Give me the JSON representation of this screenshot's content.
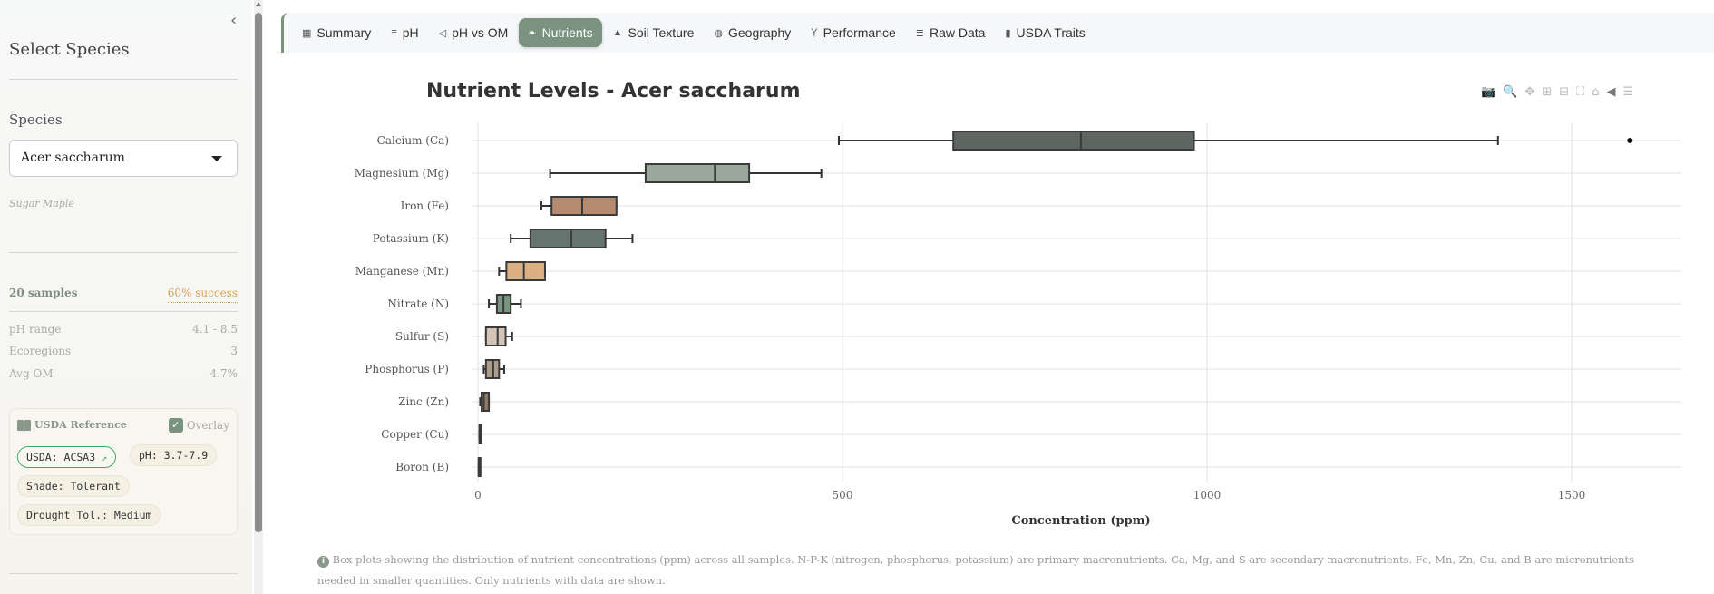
{
  "sidebar": {
    "title": "Select Species",
    "species_label": "Species",
    "species_value": "Acer saccharum",
    "common_name": "Sugar Maple",
    "samples": "20 samples",
    "success": "60% success",
    "stats": [
      {
        "label": "pH range",
        "value": "4.1 - 8.5"
      },
      {
        "label": "Ecoregions",
        "value": "3"
      },
      {
        "label": "Avg OM",
        "value": "4.7%"
      }
    ],
    "usda": {
      "title": "USDA Reference",
      "overlay": "Overlay",
      "overlay_checked": true,
      "pills": [
        "USDA: ACSA3",
        "pH: 3.7-7.9",
        "Shade: Tolerant",
        "Drought Tol.: Medium"
      ]
    }
  },
  "tabs": [
    {
      "label": "Summary",
      "icon": "▦"
    },
    {
      "label": "pH",
      "icon": "≡"
    },
    {
      "label": "pH vs OM",
      "icon": "◁"
    },
    {
      "label": "Nutrients",
      "icon": "❧"
    },
    {
      "label": "Soil Texture",
      "icon": "▲"
    },
    {
      "label": "Geography",
      "icon": "◍"
    },
    {
      "label": "Performance",
      "icon": "Ỵ"
    },
    {
      "label": "Raw Data",
      "icon": "≣"
    },
    {
      "label": "USDA Traits",
      "icon": "▮"
    }
  ],
  "active_tab": "Nutrients",
  "note": "Box plots showing the distribution of nutrient concentrations (ppm) across all samples. N-P-K (nitrogen, phosphorus, potassium) are primary macronutrients. Ca, Mg, and S are secondary macronutrients. Fe, Mn, Zn, Cu, and B are micronutrients needed in smaller quantities. Only nutrients with data are shown.",
  "chart_data": {
    "type": "box",
    "title": "Nutrient Levels - Acer saccharum",
    "xlabel": "Concentration (ppm)",
    "xlim": [
      -60,
      1660
    ],
    "xticks": [
      0,
      500,
      1000,
      1500
    ],
    "grid": true,
    "series": [
      {
        "name": "Calcium (Ca)",
        "min": 495,
        "q1": 652,
        "median": 827,
        "q3": 982,
        "max": 1399,
        "outliers": [
          1580
        ],
        "color": "#5f6661"
      },
      {
        "name": "Magnesium (Mg)",
        "min": 99,
        "q1": 230,
        "median": 325,
        "q3": 372,
        "max": 471,
        "outliers": [],
        "color": "#9aa89c"
      },
      {
        "name": "Iron (Fe)",
        "min": 87,
        "q1": 101,
        "median": 143,
        "q3": 190,
        "max": 190,
        "outliers": [],
        "color": "#b58c70"
      },
      {
        "name": "Potassium (K)",
        "min": 45,
        "q1": 72,
        "median": 128,
        "q3": 175,
        "max": 212,
        "outliers": [],
        "color": "#66746f"
      },
      {
        "name": "Manganese (Mn)",
        "min": 29,
        "q1": 39,
        "median": 63,
        "q3": 92,
        "max": 92,
        "outliers": [],
        "color": "#dcb083"
      },
      {
        "name": "Nitrate (N)",
        "min": 15,
        "q1": 26,
        "median": 35,
        "q3": 45,
        "max": 59,
        "outliers": [],
        "color": "#7a9680"
      },
      {
        "name": "Sulfur (S)",
        "min": 11,
        "q1": 11,
        "median": 27,
        "q3": 38,
        "max": 47,
        "outliers": [],
        "color": "#d4c4b6"
      },
      {
        "name": "Phosphorus (P)",
        "min": 8,
        "q1": 11,
        "median": 21,
        "q3": 29,
        "max": 36,
        "outliers": [],
        "color": "#ad9c8c"
      },
      {
        "name": "Zinc (Zn)",
        "min": 3,
        "q1": 5,
        "median": 8,
        "q3": 15,
        "max": 15,
        "outliers": [],
        "color": "#8b7865"
      },
      {
        "name": "Copper (Cu)",
        "min": 2,
        "q1": 2,
        "median": 3,
        "q3": 4,
        "max": 4,
        "outliers": [],
        "color": "#555555"
      },
      {
        "name": "Boron (B)",
        "min": 1,
        "q1": 1,
        "median": 1,
        "q3": 2,
        "max": 2,
        "outliers": [],
        "color": "#555555"
      }
    ]
  }
}
